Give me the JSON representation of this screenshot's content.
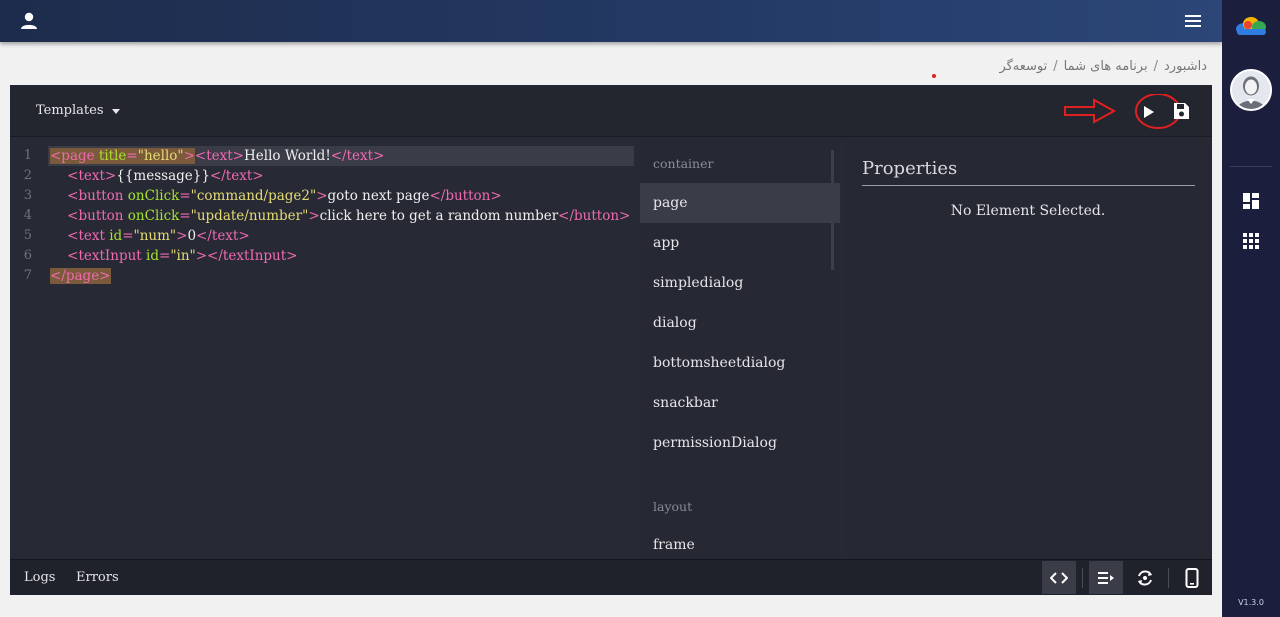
{
  "breadcrumb": [
    "داشبورد",
    "برنامه های شما",
    "توسعه‌گر"
  ],
  "toolbar": {
    "templates_label": "Templates"
  },
  "code": [
    {
      "n": "1",
      "parts": [
        [
          "hl-tag",
          "<page"
        ],
        [
          "hl-attr",
          " title"
        ],
        [
          "hl-tag",
          "="
        ],
        [
          "hl-str",
          "\"hello\""
        ],
        [
          "hl-tag",
          ">"
        ],
        [
          "tag",
          "<text>"
        ],
        [
          "txt",
          "Hello World!"
        ],
        [
          "tag",
          "</text>"
        ]
      ]
    },
    {
      "n": "2",
      "parts": [
        [
          "txt",
          "    "
        ],
        [
          "tag",
          "<text>"
        ],
        [
          "txt",
          "{{message}}"
        ],
        [
          "tag",
          "</text>"
        ]
      ]
    },
    {
      "n": "3",
      "parts": [
        [
          "txt",
          "    "
        ],
        [
          "tag",
          "<button"
        ],
        [
          "attr",
          " onClick"
        ],
        [
          "tag",
          "="
        ],
        [
          "str",
          "\"command/page2\""
        ],
        [
          "tag",
          ">"
        ],
        [
          "txt",
          "goto next page"
        ],
        [
          "tag",
          "</button>"
        ]
      ]
    },
    {
      "n": "4",
      "parts": [
        [
          "txt",
          "    "
        ],
        [
          "tag",
          "<button"
        ],
        [
          "attr",
          " onClick"
        ],
        [
          "tag",
          "="
        ],
        [
          "str",
          "\"update/number\""
        ],
        [
          "tag",
          ">"
        ],
        [
          "txt",
          "click here to get a random number"
        ],
        [
          "tag",
          "</button>"
        ]
      ]
    },
    {
      "n": "5",
      "parts": [
        [
          "txt",
          "    "
        ],
        [
          "tag",
          "<text"
        ],
        [
          "attr",
          " id"
        ],
        [
          "tag",
          "="
        ],
        [
          "str",
          "\"num\""
        ],
        [
          "tag",
          ">"
        ],
        [
          "txt",
          "0"
        ],
        [
          "tag",
          "</text>"
        ]
      ]
    },
    {
      "n": "6",
      "parts": [
        [
          "txt",
          "    "
        ],
        [
          "tag",
          "<textInput"
        ],
        [
          "attr",
          " id"
        ],
        [
          "tag",
          "="
        ],
        [
          "str",
          "\"in\""
        ],
        [
          "tag",
          "></textInput>"
        ]
      ]
    },
    {
      "n": "7",
      "parts": [
        [
          "hl-tag",
          "</page>"
        ]
      ]
    }
  ],
  "components": {
    "category_container": "container",
    "items": [
      "page",
      "app",
      "simpledialog",
      "dialog",
      "bottomsheetdialog",
      "snackbar",
      "permissionDialog"
    ],
    "selected": "page",
    "category_layout": "layout",
    "layout_items": [
      "frame"
    ]
  },
  "properties": {
    "title": "Properties",
    "empty_text": "No Element Selected."
  },
  "bottom": {
    "logs_label": "Logs",
    "errors_label": "Errors"
  },
  "sidebar": {
    "version": "V1.3.0"
  },
  "colors": {
    "tag": "#f06ab0",
    "attr": "#a6e22e",
    "string": "#e6db74",
    "annotation": "#e02020"
  }
}
